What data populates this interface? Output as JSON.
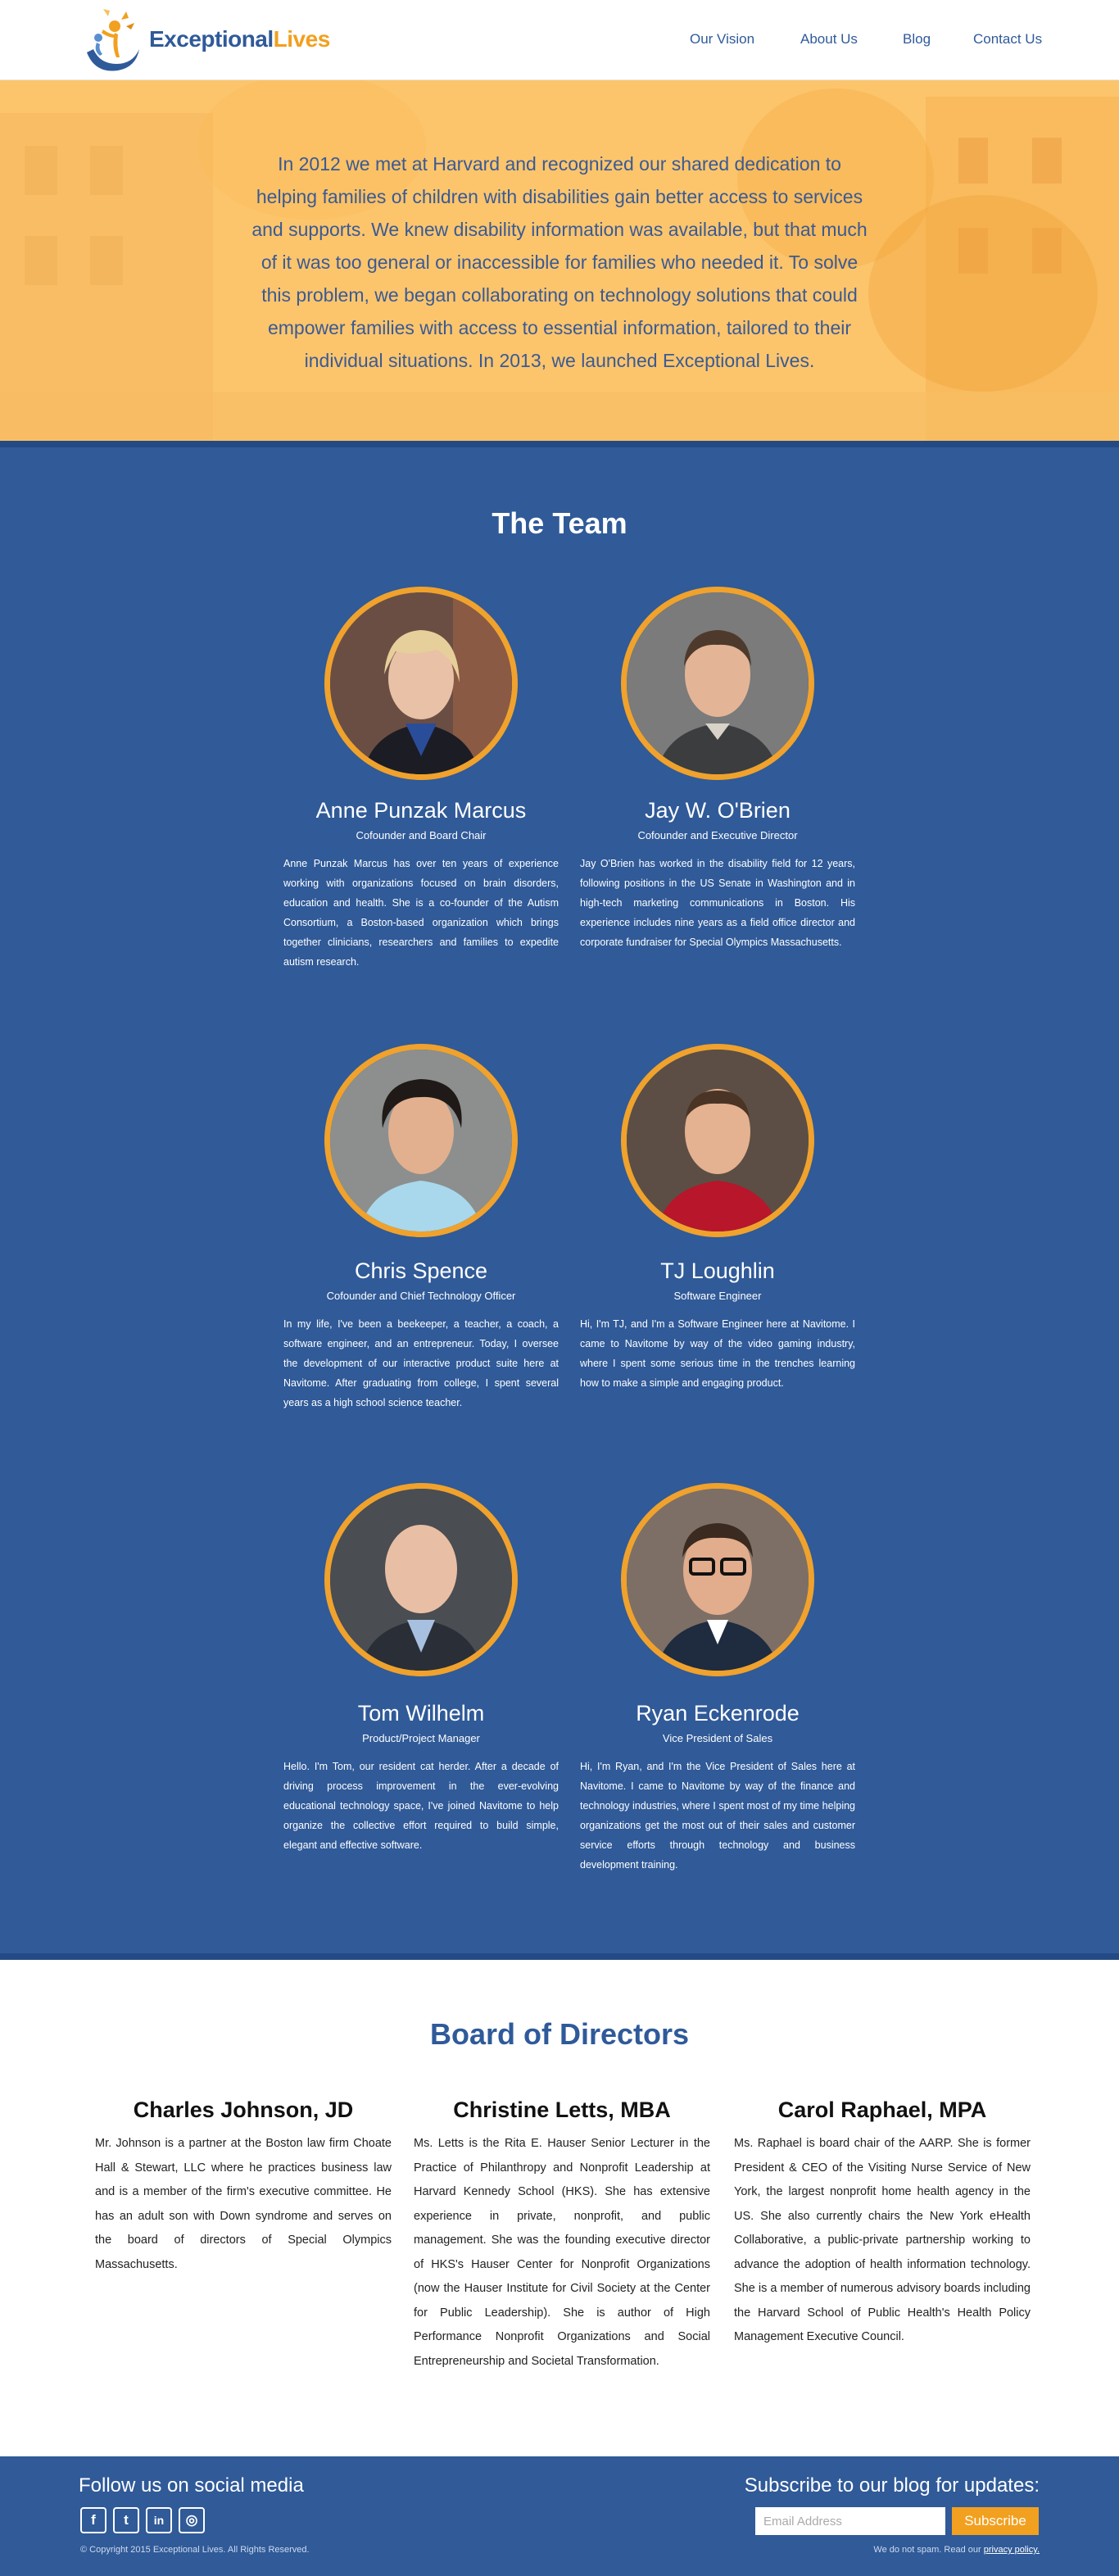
{
  "header": {
    "logo": {
      "part1": "Exceptional",
      "part2": "Lives"
    },
    "nav": [
      "Our Vision",
      "About Us",
      "Blog",
      "Contact Us"
    ]
  },
  "hero": {
    "text": "In 2012 we met at Harvard and recognized our shared dedication to helping families of children with disabilities gain better access to services and supports. We knew disability information was available, but that much of it was too general or inaccessible for families who needed it. To solve this problem, we began collaborating on technology solutions that could empower families with access to essential information, tailored to their individual situations. In 2013, we launched Exceptional Lives."
  },
  "team": {
    "title": "The Team",
    "members": [
      {
        "name": "Anne Punzak Marcus",
        "role": "Cofounder and Board Chair",
        "bio": "Anne Punzak Marcus has over ten years of experience working with organizations focused on brain disorders, education and health. She is a co-founder of the Autism Consortium, a Boston-based organization which brings together clinicians, researchers and families to expedite autism research."
      },
      {
        "name": "Jay W. O'Brien",
        "role": "Cofounder and Executive Director",
        "bio": "Jay O'Brien has worked in the disability field for 12 years, following positions in the US Senate in Washington and in high-tech marketing communications in Boston. His experience includes nine years as a field office director and corporate fundraiser for Special Olympics Massachusetts."
      },
      {
        "name": "Chris Spence",
        "role": "Cofounder and Chief Technology Officer",
        "bio": "In my life, I've been a beekeeper, a teacher, a coach, a software engineer, and an entrepreneur. Today, I oversee the development of our interactive product suite here at Navitome. After graduating from college, I  spent several years as  a high school science teacher."
      },
      {
        "name": "TJ Loughlin",
        "role": "Software Engineer",
        "bio": "Hi, I'm TJ, and I'm a Software Engineer here at Navitome. I came to Navitome by way of the video gaming industry, where I spent some serious time in the trenches learning how to make a simple and engaging product."
      },
      {
        "name": "Tom Wilhelm",
        "role": "Product/Project Manager",
        "bio": "Hello. I'm Tom, our resident cat herder. After a decade of driving process improvement in the ever-evolving educational technology space, I've joined Navitome to help organize the collective effort required to build simple, elegant and effective software."
      },
      {
        "name": "Ryan Eckenrode",
        "role": "Vice President of Sales",
        "bio": "Hi, I'm Ryan, and I'm the Vice President of Sales here at Navitome. I came to Navitome by way of the finance and technology industries, where I spent most of my time helping organizations get the most out of their sales and customer service efforts through technology and business development training."
      }
    ]
  },
  "board": {
    "title": "Board of Directors",
    "directors": [
      {
        "name": "Charles Johnson, JD",
        "bio": "Mr. Johnson is a partner at the Boston law firm Choate Hall & Stewart, LLC where he practices business law and is a member of the firm's executive committee. He has an adult son with Down syndrome and serves on the board of directors of Special Olympics Massachusetts."
      },
      {
        "name": "Christine Letts, MBA",
        "bio": "Ms. Letts is the Rita E. Hauser Senior Lecturer in the Practice of Philanthropy and Nonprofit Leadership at Harvard Kennedy School (HKS). She has extensive experience in private, nonprofit, and public management. She was the founding executive director of HKS's Hauser Center for Nonprofit Organizations (now the Hauser Institute for Civil Society at the Center for Public Leadership). She is author of High Performance Nonprofit Organizations and Social Entrepreneurship and Societal Transformation."
      },
      {
        "name": "Carol Raphael, MPA",
        "bio": "Ms. Raphael is board chair of the AARP. She is former President & CEO of the Visiting Nurse Service of New York, the largest nonprofit home health agency in the US. She also currently chairs the New York eHealth Collaborative, a public-private partnership working to advance the adoption of health information technology. She is a member of numerous advisory boards including the Harvard School of Public Health's Health Policy Management Executive Council."
      }
    ]
  },
  "footer": {
    "follow": "Follow us on social media",
    "socials": [
      {
        "icon": "facebook-icon",
        "glyph": "f"
      },
      {
        "icon": "twitter-icon",
        "glyph": "t"
      },
      {
        "icon": "linkedin-icon",
        "glyph": "in"
      },
      {
        "icon": "instagram-icon",
        "glyph": "◎"
      }
    ],
    "copyright": "© Copyright 2015 Exceptional Lives. All Rights Reserved.",
    "subscribe_title": "Subscribe to our blog for updates:",
    "email_placeholder": "Email Address",
    "subscribe_button": "Subscribe",
    "nospam": "We do not spam. Read our",
    "privacy_link": "privacy policy."
  },
  "colors": {
    "brand_blue": "#2f5a9a",
    "brand_orange": "#f2a01f",
    "team_bg": "#305a98",
    "hero_bg": "#fdc56a"
  }
}
